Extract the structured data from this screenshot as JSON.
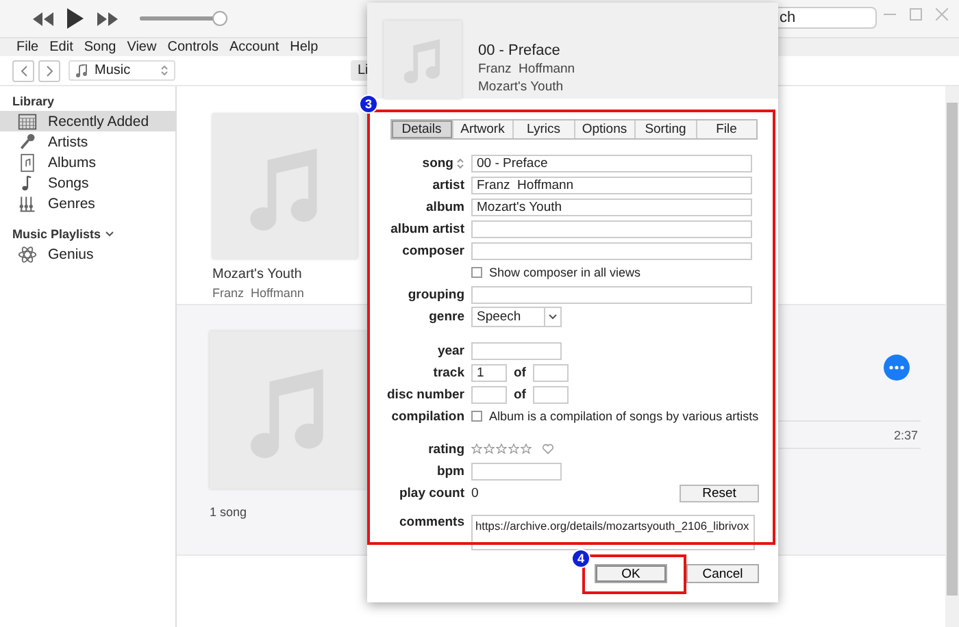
{
  "player": {
    "volume": {
      "level": 0.93
    },
    "search": {
      "value": "ch"
    }
  },
  "menu": [
    "File",
    "Edit",
    "Song",
    "View",
    "Controls",
    "Account",
    "Help"
  ],
  "nav": {
    "source": "Music",
    "view_button": "Li"
  },
  "sidebar": {
    "sections": [
      {
        "title": "Library",
        "items": [
          {
            "label": "Recently Added",
            "selected": true
          },
          {
            "label": "Artists",
            "selected": false
          },
          {
            "label": "Albums",
            "selected": false
          },
          {
            "label": "Songs",
            "selected": false
          },
          {
            "label": "Genres",
            "selected": false
          }
        ]
      },
      {
        "title": "Music Playlists",
        "expanded": true,
        "items": [
          {
            "label": "Genius",
            "selected": false
          }
        ]
      }
    ]
  },
  "albums": [
    {
      "title": "Mozart's Youth",
      "artist": "Franz  Hoffmann"
    }
  ],
  "album_detail": {
    "count": "1 song",
    "track_time": "2:37"
  },
  "dialog": {
    "header": {
      "title": "00 - Preface",
      "artist": "Franz  Hoffmann",
      "album": "Mozart's Youth"
    },
    "tabs": [
      {
        "label": "Details",
        "selected": true
      },
      {
        "label": "Artwork",
        "selected": false
      },
      {
        "label": "Lyrics",
        "selected": false
      },
      {
        "label": "Options",
        "selected": false
      },
      {
        "label": "Sorting",
        "selected": false
      },
      {
        "label": "File",
        "selected": false
      }
    ],
    "sections": [
      [
        {
          "kind": "sortable",
          "label": "song",
          "value": "00 - Preface"
        },
        {
          "kind": "text",
          "label": "artist",
          "value": "Franz  Hoffmann"
        },
        {
          "kind": "text",
          "label": "album",
          "value": "Mozart's Youth"
        },
        {
          "kind": "text",
          "label": "album artist"
        },
        {
          "kind": "text",
          "label": "composer"
        },
        {
          "kind": "checkbox",
          "text": "Show composer in all views",
          "checked": false
        },
        {
          "kind": "text",
          "label": "grouping"
        },
        {
          "kind": "select",
          "label": "genre",
          "value": "Speech"
        }
      ],
      [
        {
          "kind": "short",
          "label": "year"
        },
        {
          "kind": "pair",
          "label": "track",
          "value": "1",
          "of": "of"
        },
        {
          "kind": "pair",
          "label": "disc number",
          "of": "of"
        },
        {
          "kind": "checkbox",
          "label": "compilation",
          "text": "Album is a compilation of songs by various artists",
          "checked": false
        }
      ],
      [
        {
          "kind": "rating",
          "label": "rating",
          "stars": 0,
          "loved": false
        },
        {
          "kind": "short",
          "label": "bpm"
        },
        {
          "kind": "count",
          "label": "play count",
          "value": "0",
          "button": "Reset"
        },
        {
          "kind": "multiline",
          "label": "comments",
          "value": "https://archive.org/details/mozartsyouth_2106_librivox"
        }
      ]
    ],
    "buttons": [
      "OK",
      "Cancel"
    ]
  },
  "annotations": [
    {
      "number": "3"
    },
    {
      "number": "4"
    }
  ]
}
